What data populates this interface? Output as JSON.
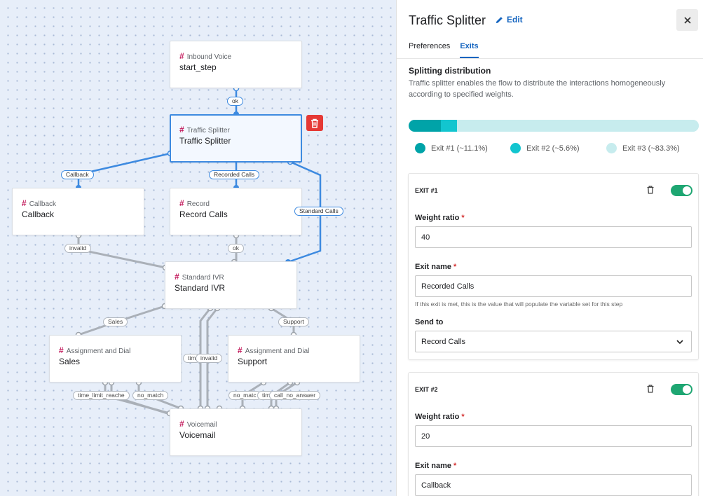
{
  "canvas": {
    "nodes": [
      {
        "id": "inbound",
        "type": "Inbound Voice",
        "name": "start_step"
      },
      {
        "id": "splitter",
        "type": "Traffic Splitter",
        "name": "Traffic Splitter"
      },
      {
        "id": "callback",
        "type": "Callback",
        "name": "Callback"
      },
      {
        "id": "record",
        "type": "Record",
        "name": "Record Calls"
      },
      {
        "id": "ivr",
        "type": "Standard IVR",
        "name": "Standard IVR"
      },
      {
        "id": "sales",
        "type": "Assignment and Dial",
        "name": "Sales"
      },
      {
        "id": "support",
        "type": "Assignment and Dial",
        "name": "Support"
      },
      {
        "id": "voicemail",
        "type": "Voicemail",
        "name": "Voicemail"
      }
    ],
    "edge_labels": {
      "ok1": "ok",
      "callback": "Callback",
      "recorded": "Recorded Calls",
      "standard": "Standard Calls",
      "invalid1": "invalid",
      "ok2": "ok",
      "sales": "Sales",
      "support": "Support",
      "tim1": "tim",
      "invalid2": "invalid",
      "time_limit": "time_limit_reache",
      "no_match1": "no_match",
      "no_match2": "no_matc",
      "tim2": "tim",
      "call_no_answer": "call_no_answer"
    },
    "hash": "#"
  },
  "panel": {
    "title": "Traffic Splitter",
    "edit_label": "Edit",
    "tabs": [
      {
        "label": "Preferences",
        "active": false
      },
      {
        "label": "Exits",
        "active": true
      }
    ],
    "section_title": "Splitting distribution",
    "section_desc": "Traffic splitter enables the flow to distribute the interactions homogeneously according to specified weights.",
    "distribution": [
      {
        "label": "Exit #1 (~11.1%)",
        "fraction": 0.111,
        "color": "#00a3a8"
      },
      {
        "label": "Exit #2 (~5.6%)",
        "fraction": 0.056,
        "color": "#12c5cf"
      },
      {
        "label": "Exit #3 (~83.3%)",
        "fraction": 0.833,
        "color": "#c7ecee"
      }
    ],
    "exits": [
      {
        "heading": "EXIT #1",
        "enabled": true,
        "weight_label": "Weight ratio",
        "weight_value": "40",
        "name_label": "Exit name",
        "name_value": "Recorded Calls",
        "help": "If this exit is met, this is the value that will populate the variable set for this step",
        "send_label": "Send to",
        "send_value": "Record Calls"
      },
      {
        "heading": "EXIT #2",
        "enabled": true,
        "weight_label": "Weight ratio",
        "weight_value": "20",
        "name_label": "Exit name",
        "name_value": "Callback"
      }
    ],
    "required_mark": "*"
  },
  "colors": {
    "accent": "#1565c0",
    "selected_edge": "#3d8ae0",
    "toggle_on": "#1ea672",
    "delete": "#e53935"
  }
}
